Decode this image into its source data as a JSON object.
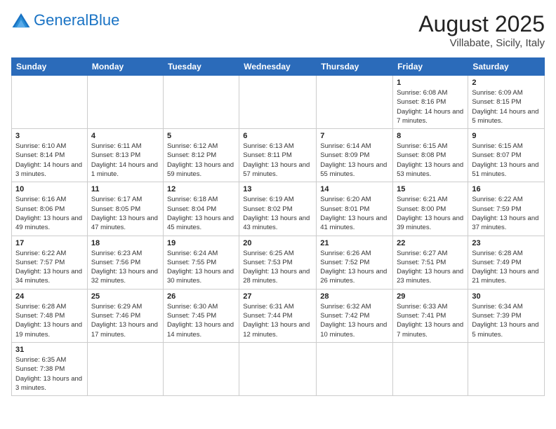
{
  "header": {
    "logo_general": "General",
    "logo_blue": "Blue",
    "title": "August 2025",
    "subtitle": "Villabate, Sicily, Italy"
  },
  "days_of_week": [
    "Sunday",
    "Monday",
    "Tuesday",
    "Wednesday",
    "Thursday",
    "Friday",
    "Saturday"
  ],
  "weeks": [
    [
      {
        "day": "",
        "info": ""
      },
      {
        "day": "",
        "info": ""
      },
      {
        "day": "",
        "info": ""
      },
      {
        "day": "",
        "info": ""
      },
      {
        "day": "",
        "info": ""
      },
      {
        "day": "1",
        "info": "Sunrise: 6:08 AM\nSunset: 8:16 PM\nDaylight: 14 hours and 7 minutes."
      },
      {
        "day": "2",
        "info": "Sunrise: 6:09 AM\nSunset: 8:15 PM\nDaylight: 14 hours and 5 minutes."
      }
    ],
    [
      {
        "day": "3",
        "info": "Sunrise: 6:10 AM\nSunset: 8:14 PM\nDaylight: 14 hours and 3 minutes."
      },
      {
        "day": "4",
        "info": "Sunrise: 6:11 AM\nSunset: 8:13 PM\nDaylight: 14 hours and 1 minute."
      },
      {
        "day": "5",
        "info": "Sunrise: 6:12 AM\nSunset: 8:12 PM\nDaylight: 13 hours and 59 minutes."
      },
      {
        "day": "6",
        "info": "Sunrise: 6:13 AM\nSunset: 8:11 PM\nDaylight: 13 hours and 57 minutes."
      },
      {
        "day": "7",
        "info": "Sunrise: 6:14 AM\nSunset: 8:09 PM\nDaylight: 13 hours and 55 minutes."
      },
      {
        "day": "8",
        "info": "Sunrise: 6:15 AM\nSunset: 8:08 PM\nDaylight: 13 hours and 53 minutes."
      },
      {
        "day": "9",
        "info": "Sunrise: 6:15 AM\nSunset: 8:07 PM\nDaylight: 13 hours and 51 minutes."
      }
    ],
    [
      {
        "day": "10",
        "info": "Sunrise: 6:16 AM\nSunset: 8:06 PM\nDaylight: 13 hours and 49 minutes."
      },
      {
        "day": "11",
        "info": "Sunrise: 6:17 AM\nSunset: 8:05 PM\nDaylight: 13 hours and 47 minutes."
      },
      {
        "day": "12",
        "info": "Sunrise: 6:18 AM\nSunset: 8:04 PM\nDaylight: 13 hours and 45 minutes."
      },
      {
        "day": "13",
        "info": "Sunrise: 6:19 AM\nSunset: 8:02 PM\nDaylight: 13 hours and 43 minutes."
      },
      {
        "day": "14",
        "info": "Sunrise: 6:20 AM\nSunset: 8:01 PM\nDaylight: 13 hours and 41 minutes."
      },
      {
        "day": "15",
        "info": "Sunrise: 6:21 AM\nSunset: 8:00 PM\nDaylight: 13 hours and 39 minutes."
      },
      {
        "day": "16",
        "info": "Sunrise: 6:22 AM\nSunset: 7:59 PM\nDaylight: 13 hours and 37 minutes."
      }
    ],
    [
      {
        "day": "17",
        "info": "Sunrise: 6:22 AM\nSunset: 7:57 PM\nDaylight: 13 hours and 34 minutes."
      },
      {
        "day": "18",
        "info": "Sunrise: 6:23 AM\nSunset: 7:56 PM\nDaylight: 13 hours and 32 minutes."
      },
      {
        "day": "19",
        "info": "Sunrise: 6:24 AM\nSunset: 7:55 PM\nDaylight: 13 hours and 30 minutes."
      },
      {
        "day": "20",
        "info": "Sunrise: 6:25 AM\nSunset: 7:53 PM\nDaylight: 13 hours and 28 minutes."
      },
      {
        "day": "21",
        "info": "Sunrise: 6:26 AM\nSunset: 7:52 PM\nDaylight: 13 hours and 26 minutes."
      },
      {
        "day": "22",
        "info": "Sunrise: 6:27 AM\nSunset: 7:51 PM\nDaylight: 13 hours and 23 minutes."
      },
      {
        "day": "23",
        "info": "Sunrise: 6:28 AM\nSunset: 7:49 PM\nDaylight: 13 hours and 21 minutes."
      }
    ],
    [
      {
        "day": "24",
        "info": "Sunrise: 6:28 AM\nSunset: 7:48 PM\nDaylight: 13 hours and 19 minutes."
      },
      {
        "day": "25",
        "info": "Sunrise: 6:29 AM\nSunset: 7:46 PM\nDaylight: 13 hours and 17 minutes."
      },
      {
        "day": "26",
        "info": "Sunrise: 6:30 AM\nSunset: 7:45 PM\nDaylight: 13 hours and 14 minutes."
      },
      {
        "day": "27",
        "info": "Sunrise: 6:31 AM\nSunset: 7:44 PM\nDaylight: 13 hours and 12 minutes."
      },
      {
        "day": "28",
        "info": "Sunrise: 6:32 AM\nSunset: 7:42 PM\nDaylight: 13 hours and 10 minutes."
      },
      {
        "day": "29",
        "info": "Sunrise: 6:33 AM\nSunset: 7:41 PM\nDaylight: 13 hours and 7 minutes."
      },
      {
        "day": "30",
        "info": "Sunrise: 6:34 AM\nSunset: 7:39 PM\nDaylight: 13 hours and 5 minutes."
      }
    ],
    [
      {
        "day": "31",
        "info": "Sunrise: 6:35 AM\nSunset: 7:38 PM\nDaylight: 13 hours and 3 minutes."
      },
      {
        "day": "",
        "info": ""
      },
      {
        "day": "",
        "info": ""
      },
      {
        "day": "",
        "info": ""
      },
      {
        "day": "",
        "info": ""
      },
      {
        "day": "",
        "info": ""
      },
      {
        "day": "",
        "info": ""
      }
    ]
  ]
}
